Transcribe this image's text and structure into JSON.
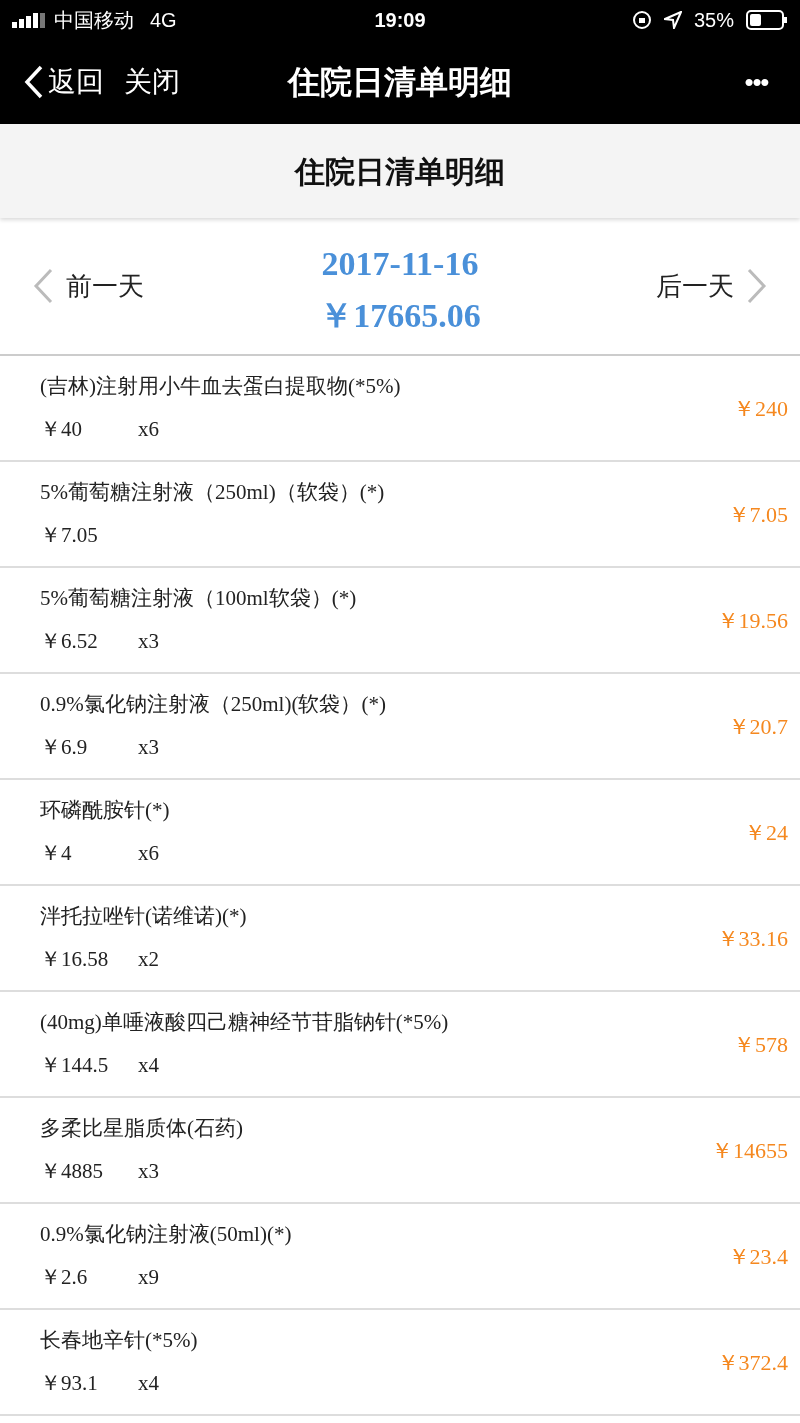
{
  "status_bar": {
    "carrier": "中国移动",
    "network": "4G",
    "time": "19:09",
    "battery": "35%"
  },
  "nav_bar": {
    "back": "返回",
    "close": "关闭",
    "title": "住院日清单明细",
    "more": "•••"
  },
  "page_header": {
    "title": "住院日清单明细"
  },
  "date_bar": {
    "prev": "前一天",
    "date": "2017-11-16",
    "total": "￥17665.06",
    "next": "后一天"
  },
  "items": [
    {
      "name": "(吉林)注射用小牛血去蛋白提取物(*5%)",
      "price": "￥40",
      "qty": "x6",
      "amount": "￥240"
    },
    {
      "name": "5%葡萄糖注射液（250ml)（软袋）(*)",
      "price": "￥7.05",
      "amount": "￥7.05"
    },
    {
      "name": "5%葡萄糖注射液（100ml软袋）(*)",
      "price": "￥6.52",
      "qty": "x3",
      "amount": "￥19.56"
    },
    {
      "name": "0.9%氯化钠注射液（250ml)(软袋）(*)",
      "price": "￥6.9",
      "qty": "x3",
      "amount": "￥20.7"
    },
    {
      "name": "环磷酰胺针(*)",
      "price": "￥4",
      "qty": "x6",
      "amount": "￥24"
    },
    {
      "name": "泮托拉唑针(诺维诺)(*)",
      "price": "￥16.58",
      "qty": "x2",
      "amount": "￥33.16"
    },
    {
      "name": "(40mg)单唾液酸四己糖神经节苷脂钠针(*5%)",
      "price": "￥144.5",
      "qty": "x4",
      "amount": "￥578"
    },
    {
      "name": "多柔比星脂质体(石药)",
      "price": "￥4885",
      "qty": "x3",
      "amount": "￥14655"
    },
    {
      "name": "0.9%氯化钠注射液(50ml)(*)",
      "price": "￥2.6",
      "qty": "x9",
      "amount": "￥23.4"
    },
    {
      "name": "长春地辛针(*5%)",
      "price": "￥93.1",
      "qty": "x4",
      "amount": "￥372.4"
    }
  ]
}
